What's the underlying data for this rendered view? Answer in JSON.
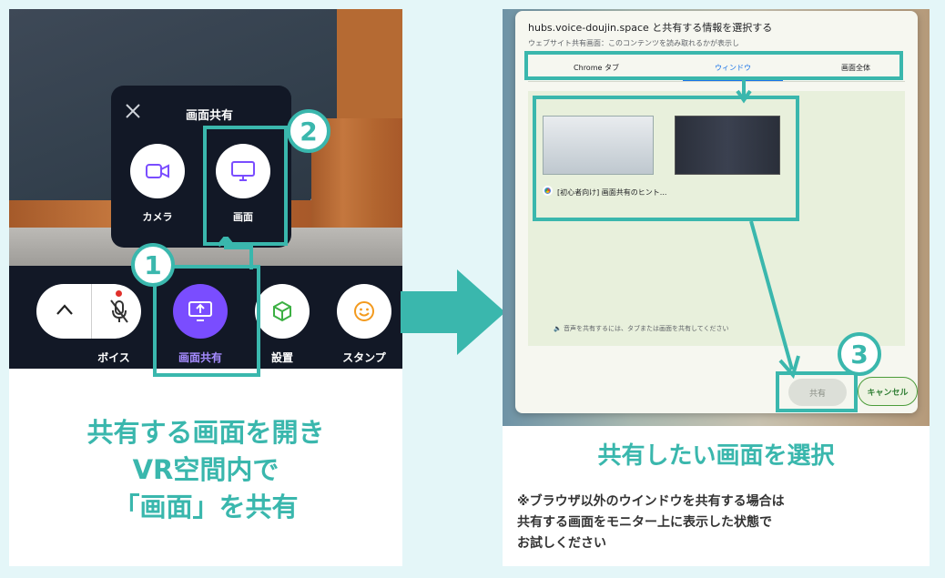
{
  "left": {
    "popup": {
      "title": "画面共有",
      "camera_label": "カメラ",
      "screen_label": "画面"
    },
    "toolbar": {
      "voice_label": "ボイス",
      "share_label": "画面共有",
      "place_label": "設置",
      "stamp_label": "スタンプ"
    },
    "badges": [
      "1",
      "2"
    ],
    "caption": [
      "共有する画面を開き",
      "VR空間内で",
      "「画面」を共有"
    ]
  },
  "right": {
    "dialog": {
      "title": "hubs.voice-doujin.space と共有する情報を選択する",
      "subtitle": "ウェブサイト共有画面：このコンテンツを読み取れるかが表示し",
      "tabs": [
        "Chrome タブ",
        "ウィンドウ",
        "画面全体"
      ],
      "active_tab": "ウィンドウ",
      "window_item_label": "[初心者向け] 画面共有のヒント...",
      "audio_hint": "音声を共有するには、タブまたは画面を共有してください",
      "share_button": "共有",
      "cancel_button": "キャンセル"
    },
    "badges": [
      "3"
    ],
    "title": "共有したい画面を選択",
    "note": [
      "※ブラウザ以外のウインドウを共有する場合は",
      "共有する画面をモニター上に表示した状態で",
      "お試しください"
    ]
  },
  "colors": {
    "accent_teal": "#3ab7ad",
    "share_purple": "#7a4dff",
    "toolbar_dark": "#121826"
  }
}
